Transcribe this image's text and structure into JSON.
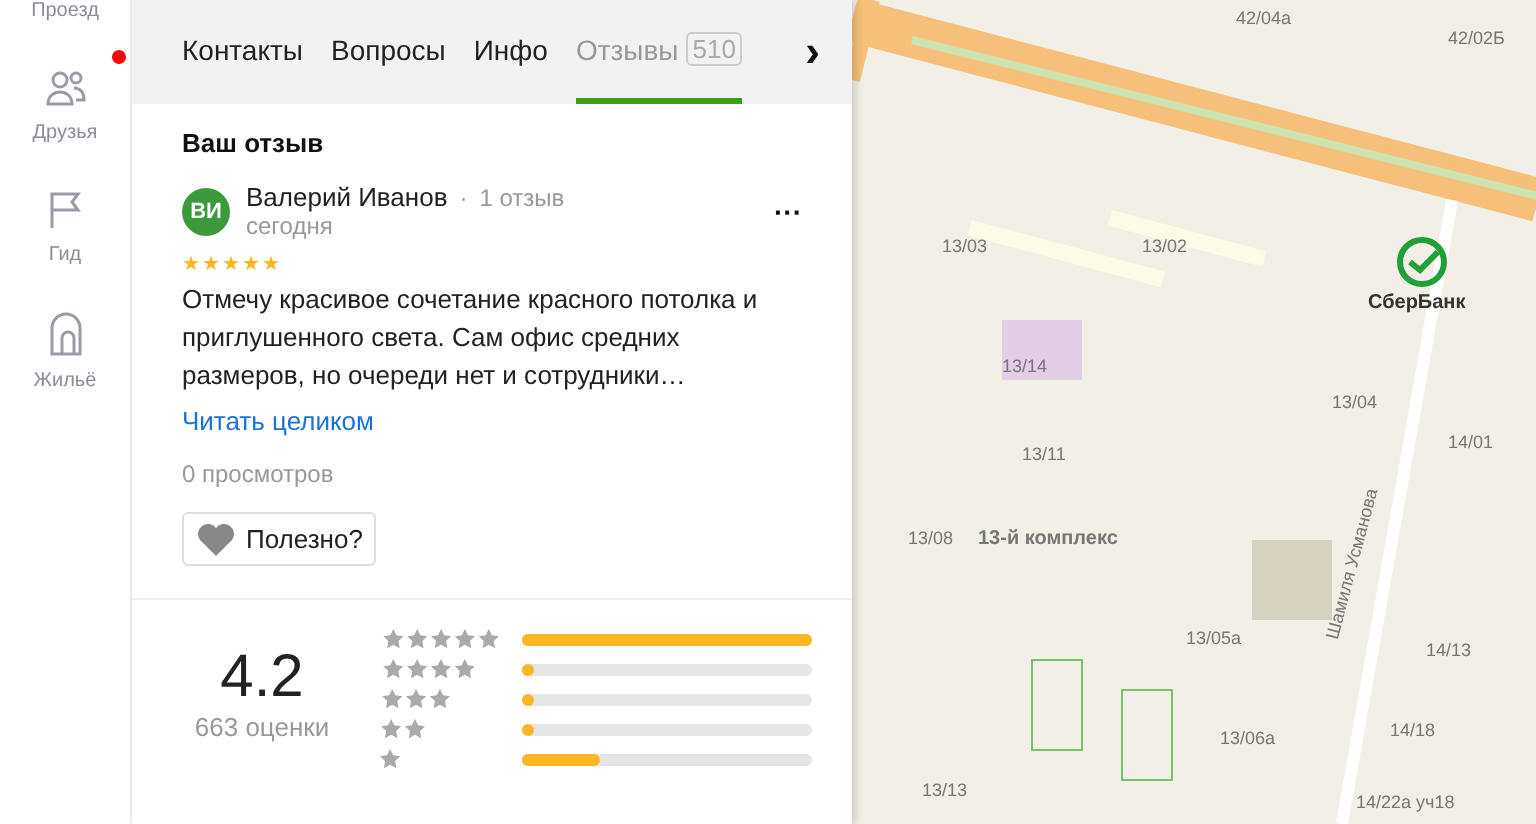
{
  "rail": [
    {
      "label": "Проезд",
      "badge": false
    },
    {
      "label": "Друзья",
      "badge": true
    },
    {
      "label": "Гид",
      "badge": false
    },
    {
      "label": "Жильё",
      "badge": false
    }
  ],
  "tabs": [
    {
      "label": "Контакты",
      "selected": false
    },
    {
      "label": "Вопросы",
      "selected": false
    },
    {
      "label": "Инфо",
      "selected": false
    },
    {
      "label": "Отзывы",
      "count": "510",
      "selected": true
    }
  ],
  "tabs_more": "›",
  "your_review": {
    "title": "Ваш отзыв",
    "initials": "ВИ",
    "author": "Валерий Иванов",
    "separator": "·",
    "reviews": "1 отзыв",
    "date": "сегодня",
    "more": "···",
    "stars": 5,
    "text": "Отмечу красивое сочетание красного потолка и приглушенного света. Сам офис средних размеров, но очереди нет и сотрудники…",
    "read_more": "Читать целиком",
    "views": "0 просмотров",
    "useful": "Полезно?"
  },
  "rating": {
    "value": "4.2",
    "count": "663 оценки",
    "rows": [
      {
        "level": 1.0
      },
      {
        "level": 0.03
      },
      {
        "level": 0.03
      },
      {
        "level": 0.03
      },
      {
        "level": 0.27
      }
    ]
  },
  "map": {
    "labels": [
      {
        "text": "42/04а",
        "kind": "house"
      },
      {
        "text": "42/02Б",
        "kind": "house"
      },
      {
        "text": "13/03",
        "kind": "house"
      },
      {
        "text": "13/02",
        "kind": "house"
      },
      {
        "text": "13/14",
        "kind": "house"
      },
      {
        "text": "13/04",
        "kind": "house"
      },
      {
        "text": "14/01",
        "kind": "house"
      },
      {
        "text": "13/11",
        "kind": "house"
      },
      {
        "text": "13/08",
        "kind": "house"
      },
      {
        "text": "13-й комплекс",
        "kind": "district"
      },
      {
        "text": "13/05а",
        "kind": "house"
      },
      {
        "text": "14/13",
        "kind": "house"
      },
      {
        "text": "13/06а",
        "kind": "house"
      },
      {
        "text": "14/18",
        "kind": "house"
      },
      {
        "text": "13/13",
        "kind": "house"
      },
      {
        "text": "14/22а уч18",
        "kind": "house"
      },
      {
        "text": "Шамиля Усманова",
        "kind": "street"
      }
    ],
    "poi": {
      "name": "СберБанк"
    }
  }
}
